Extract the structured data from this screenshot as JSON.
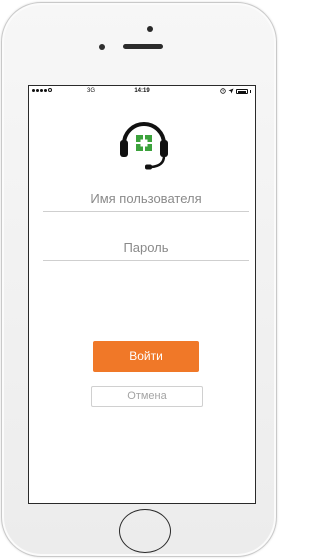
{
  "status_bar": {
    "network": "3G",
    "time": "14:19",
    "signal_icon": "signal-dots-icon",
    "location_icon": "location-arrow-icon",
    "battery_icon": "battery-icon"
  },
  "app": {
    "logo_icon": "headset-support-icon",
    "brand_color": "#f07828",
    "logo_accent": "#3ca23c"
  },
  "login_form": {
    "username_placeholder": "Имя пользователя",
    "password_placeholder": "Пароль",
    "login_label": "Войти",
    "cancel_label": "Отмена"
  }
}
